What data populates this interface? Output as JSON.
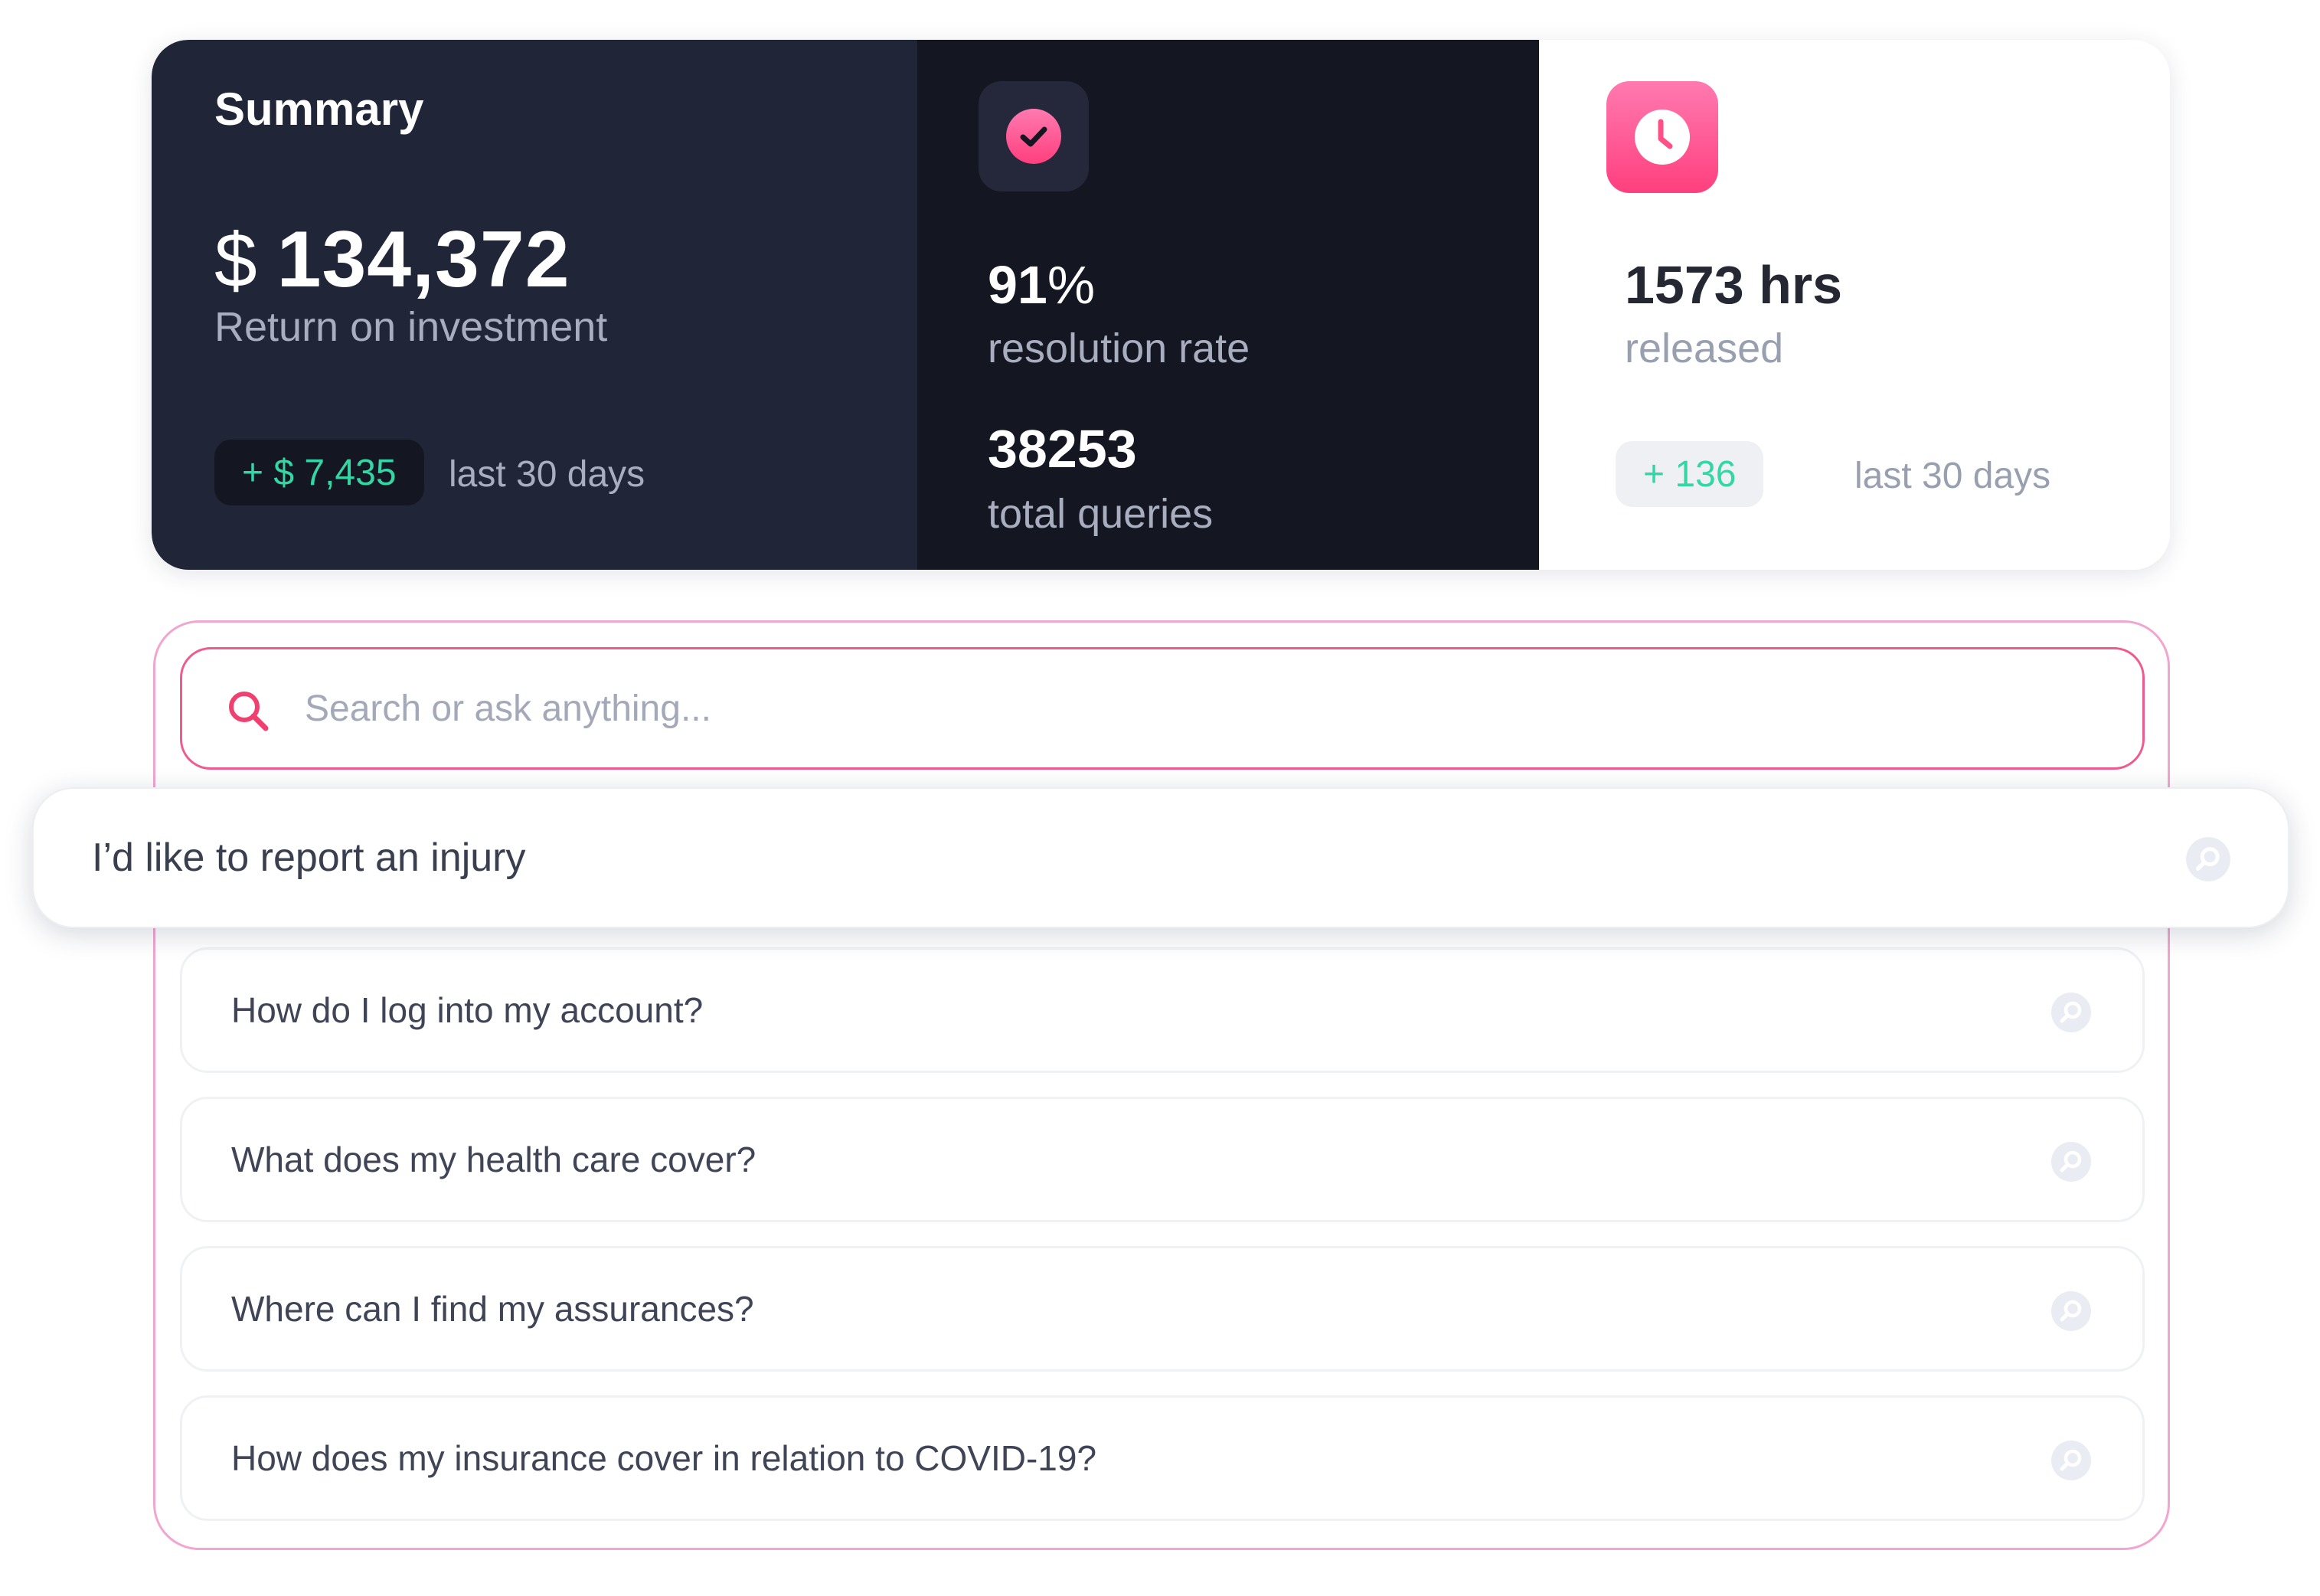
{
  "summary": {
    "title": "Summary",
    "roi": {
      "currency": "$",
      "value": "134,372",
      "label": "Return on investment",
      "delta": "+ $ 7,435",
      "period": "last 30 days"
    },
    "resolution": {
      "icon": "check-circle-icon",
      "rate_value": "91",
      "rate_unit": "%",
      "rate_label": "resolution rate",
      "queries_value": "38253",
      "queries_label": "total queries"
    },
    "hours": {
      "icon": "clock-icon",
      "value": "1573 hrs",
      "label": "released",
      "delta": "+ 136",
      "period": "last 30 days"
    }
  },
  "search": {
    "icon": "search-icon",
    "placeholder": "Search or ask anything...",
    "highlighted_suggestion": "I’d like to report an injury",
    "suggestions": [
      "How do I log into my account?",
      "What does my health care cover?",
      "Where can I find my assurances?",
      "How does my insurance cover in relation to COVID-19?"
    ]
  },
  "colors": {
    "accent_pink": "#ff3f7e",
    "positive_green": "#34d6a6",
    "dark_panel": "#212538",
    "darker_panel": "#141722"
  }
}
